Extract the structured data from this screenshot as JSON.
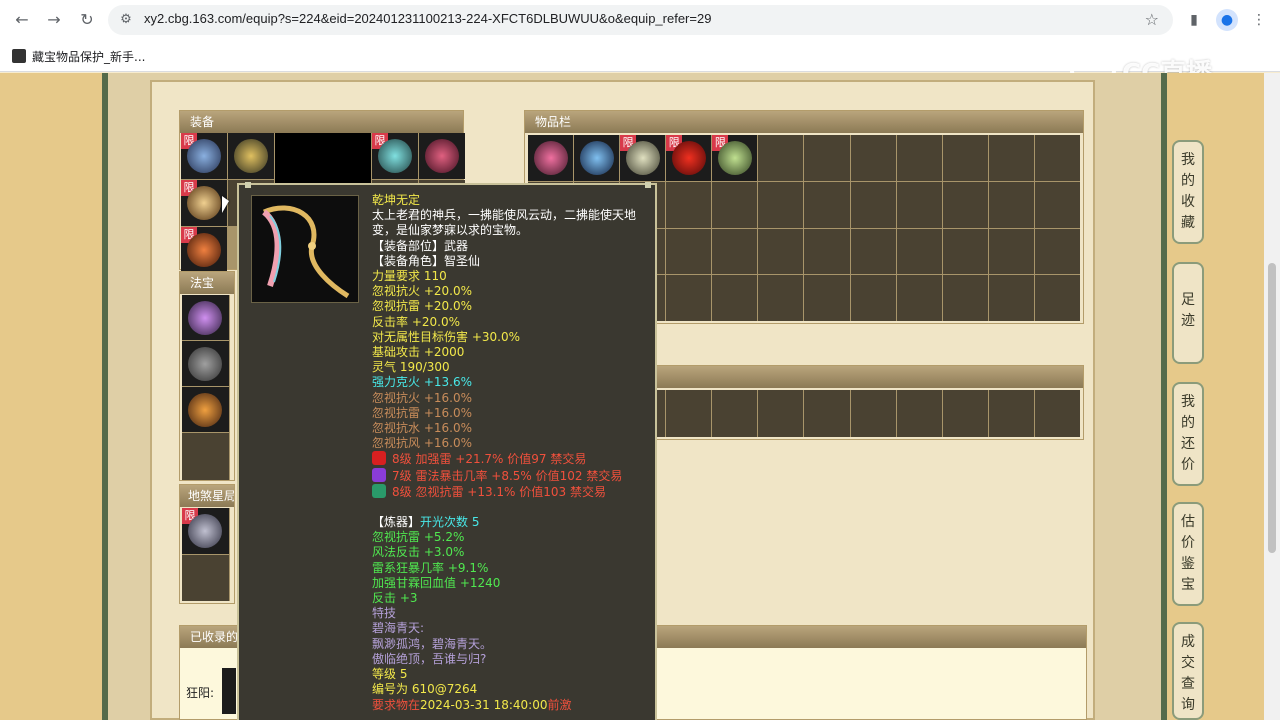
{
  "browser": {
    "url": "xy2.cbg.163.com/equip?s=224&eid=202401231100213-224-XFCT6DLBUWUU&o&equip_refer=29",
    "bookmark": "藏宝物品保护_新手..."
  },
  "watermark": "CC直播",
  "panels": {
    "equipment": "装备",
    "fabao": "法宝",
    "dishaxing": "地煞星局",
    "inventory": "物品栏",
    "collected": "已收录的"
  },
  "limited_badge": "限",
  "collected_label": "狂阳:",
  "sidebar": {
    "tabs": [
      "我的收藏",
      "足迹",
      "我的还价",
      "估价鉴宝",
      "成交查询"
    ]
  },
  "tooltip": {
    "name": "乾坤无定",
    "description": "太上老君的神兵，一拂能使风云动，二拂能使天地变，是仙家梦寐以求的宝物。",
    "slot": "【装备部位】武器",
    "role": "【装备角色】智圣仙",
    "base": [
      "力量要求 110",
      "忽视抗火 +20.0%",
      "忽视抗雷 +20.0%",
      "反击率 +20.0%",
      "对无属性目标伤害 +30.0%",
      "基础攻击 +2000",
      "灵气 190/300"
    ],
    "strong": "强力克火 +13.6%",
    "weak": [
      "忽视抗火 +16.0%",
      "忽视抗雷 +16.0%",
      "忽视抗水 +16.0%",
      "忽视抗风 +16.0%"
    ],
    "gems": [
      "8级 加强雷 +21.7% 价值97 禁交易",
      "7级 雷法暴击几率 +8.5% 价值102 禁交易",
      "8级 忽视抗雷 +13.1% 价值103 禁交易"
    ],
    "refine_label": "【炼器】",
    "refine_count": "开光次数 5",
    "refine": [
      "忽视抗雷 +5.2%",
      "风法反击 +3.0%",
      "雷系狂暴几率 +9.1%",
      "加强甘霖回血值 +1240",
      "反击 +3"
    ],
    "skill_title": "特技",
    "skill_name": "碧海青天:",
    "skill_desc1": "飘渺孤鸿，碧海青天。",
    "skill_desc2": "傲临绝顶，吾谁与归?",
    "level": "等级 5",
    "serial": "编号为 610@7264",
    "time_prefix": "要求物在",
    "time": "2024-03-31 18:40:00",
    "time_suffix": "前激"
  },
  "colors": {
    "gem1": "#d82020",
    "gem2": "#8a3cd8",
    "gem3": "#2a9a6a"
  }
}
